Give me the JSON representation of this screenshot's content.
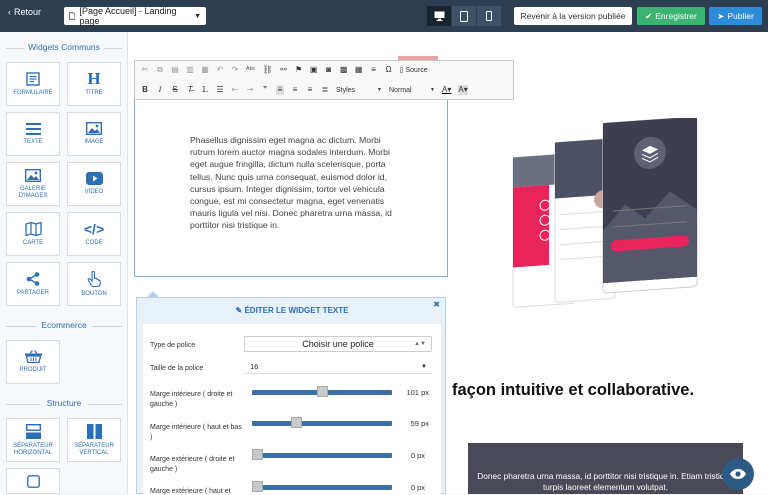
{
  "topbar": {
    "back_label": "Retour",
    "page_select": "[Page Accueil] - Landing page",
    "revert_label": "Revenir à la version publiée",
    "save_label": "Enregistrer",
    "publish_label": "Publier",
    "devices": [
      "desktop-icon",
      "tablet-icon",
      "mobile-icon"
    ]
  },
  "sidebar": {
    "sections": {
      "common": "Widgets Communs",
      "ecommerce": "Ecommerce",
      "structure": "Structure"
    },
    "widgets": [
      {
        "label": "FORMULAIRE",
        "icon": "form-icon"
      },
      {
        "label": "TITRE",
        "icon": "heading-icon"
      },
      {
        "label": "TEXTE",
        "icon": "text-icon"
      },
      {
        "label": "IMAGE",
        "icon": "image-icon"
      },
      {
        "label": "GALERIE D'IMAGES",
        "icon": "gallery-icon"
      },
      {
        "label": "VIDEO",
        "icon": "video-icon"
      },
      {
        "label": "CARTE",
        "icon": "map-icon"
      },
      {
        "label": "CODE",
        "icon": "code-icon"
      },
      {
        "label": "PARTAGER",
        "icon": "share-icon"
      },
      {
        "label": "BOUTON",
        "icon": "pointer-icon"
      }
    ],
    "ecommerce_widgets": [
      {
        "label": "PRODUIT",
        "icon": "basket-icon"
      }
    ],
    "structure_widgets": [
      {
        "label": "SÉPARATEUR HORIZONTAL",
        "icon": "horizontal-separator-icon"
      },
      {
        "label": "SÉPARATEUR VERTICAL",
        "icon": "vertical-separator-icon"
      }
    ]
  },
  "editor": {
    "source_label": "Source",
    "styles_label": "Styles",
    "format_label": "Normal",
    "paragraph": "Phasellus dignissim eget magna ac dictum. Morbi rutrum lorem auctor magna sodales interdum. Morbi eget augue fringilla, dictum nulla scelerisque, porta tellus. Nunc quis urna consequat, euismod dolor id, cursus ipsum. Integer dignissim, tortor vel vehicula congue, est mi consectetur magna, eget venenatis mauris ligula vel nisi. Donec pharetra urna massa, id porttitor nisi tristique in."
  },
  "panel": {
    "title": "ÉDITER LE WIDGET TEXTE",
    "font_label": "Type de police",
    "font_value": "Choisir une police",
    "size_label": "Taille de la police",
    "size_value": "16",
    "sliders": [
      {
        "label": "Marge intérieure ( droite et gauche )",
        "value": "101 px",
        "fraction": 0.5
      },
      {
        "label": "Marge intérieure ( haut et bas )",
        "value": "59 px",
        "fraction": 0.3
      },
      {
        "label": "Marge extérieure ( droite et gauche )",
        "value": "0 px",
        "fraction": 0.0
      },
      {
        "label": "Marge extérieure ( haut et bas )",
        "value": "0 px",
        "fraction": 0.0
      }
    ]
  },
  "page": {
    "heading": "façon intuitive et collaborative.",
    "dark_text": "Donec pharetra urna massa, id porttitor nisi tristique in. Etiam tristique turpis laoreet elementum volutpat."
  },
  "colors": {
    "topbar": "#2c3e50",
    "accent": "#2c6fb7",
    "save": "#3cb371",
    "publish": "#2d8cd8"
  }
}
